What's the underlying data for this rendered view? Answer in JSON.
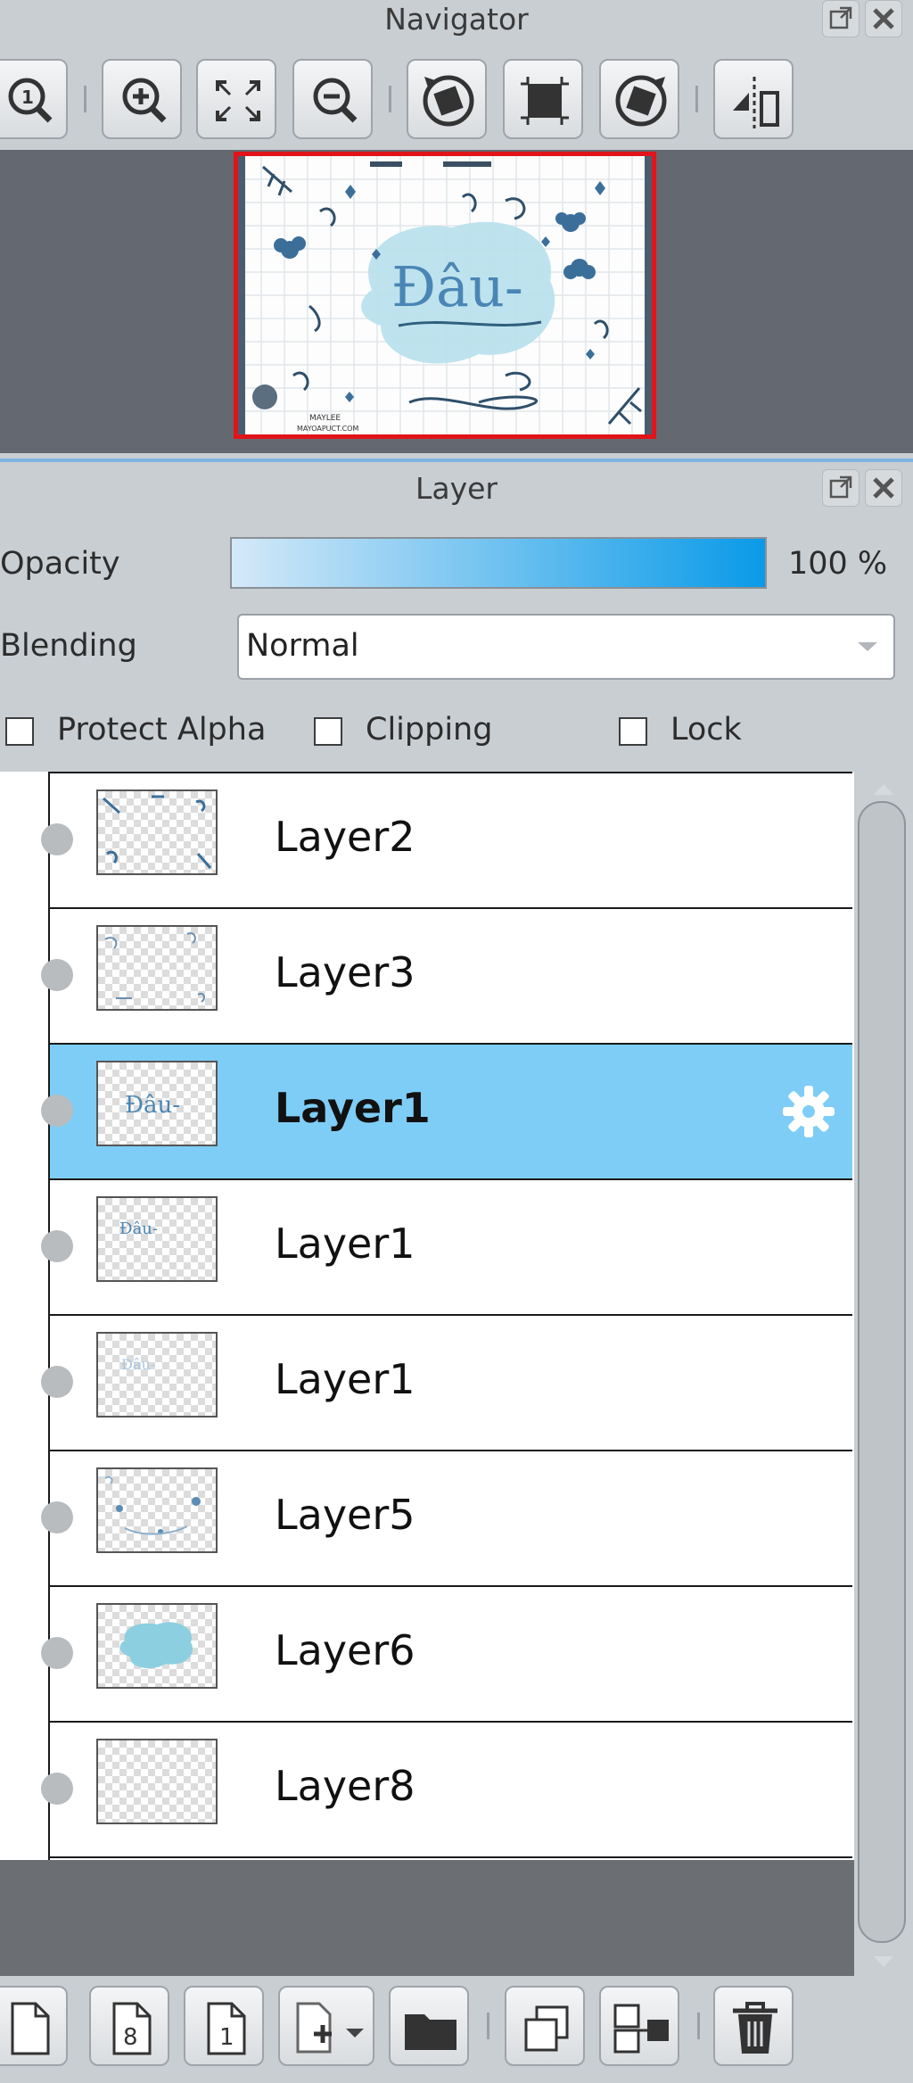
{
  "navigator": {
    "title": "Navigator",
    "toolbar_icons": [
      "zoom-actual-icon",
      "zoom-in-icon",
      "fit-screen-icon",
      "zoom-out-icon",
      "rotate-left-icon",
      "reset-view-icon",
      "rotate-right-icon",
      "flip-horizontal-icon"
    ]
  },
  "layer_panel": {
    "title": "Layer",
    "opacity_label": "Opacity",
    "opacity_value": "100 %",
    "opacity_fraction": 1.0,
    "blending_label": "Blending",
    "blending_value": "Normal",
    "protect_alpha_label": "Protect Alpha",
    "clipping_label": "Clipping",
    "lock_label": "Lock",
    "layers": [
      {
        "name": "Layer2",
        "selected": false
      },
      {
        "name": "Layer3",
        "selected": false
      },
      {
        "name": "Layer1",
        "selected": true
      },
      {
        "name": "Layer1",
        "selected": false
      },
      {
        "name": "Layer1",
        "selected": false
      },
      {
        "name": "Layer5",
        "selected": false
      },
      {
        "name": "Layer6",
        "selected": false
      },
      {
        "name": "Layer8",
        "selected": false
      }
    ],
    "bottom_toolbar_icons": [
      "new-layer-icon",
      "new-layer-8bit-icon",
      "new-layer-1bit-icon",
      "add-layer-menu-icon",
      "new-folder-icon",
      "duplicate-layer-icon",
      "merge-down-icon",
      "delete-layer-icon"
    ]
  },
  "thumbnail_text": {
    "main": "Đâu-",
    "credit_line_1": "MAYLEE",
    "credit_line_2": "MAYOAPUCT.COM"
  },
  "colors": {
    "accent": "#0a9ae8",
    "selected_row": "#7ecdf6",
    "nav_frame": "#e0141a"
  }
}
